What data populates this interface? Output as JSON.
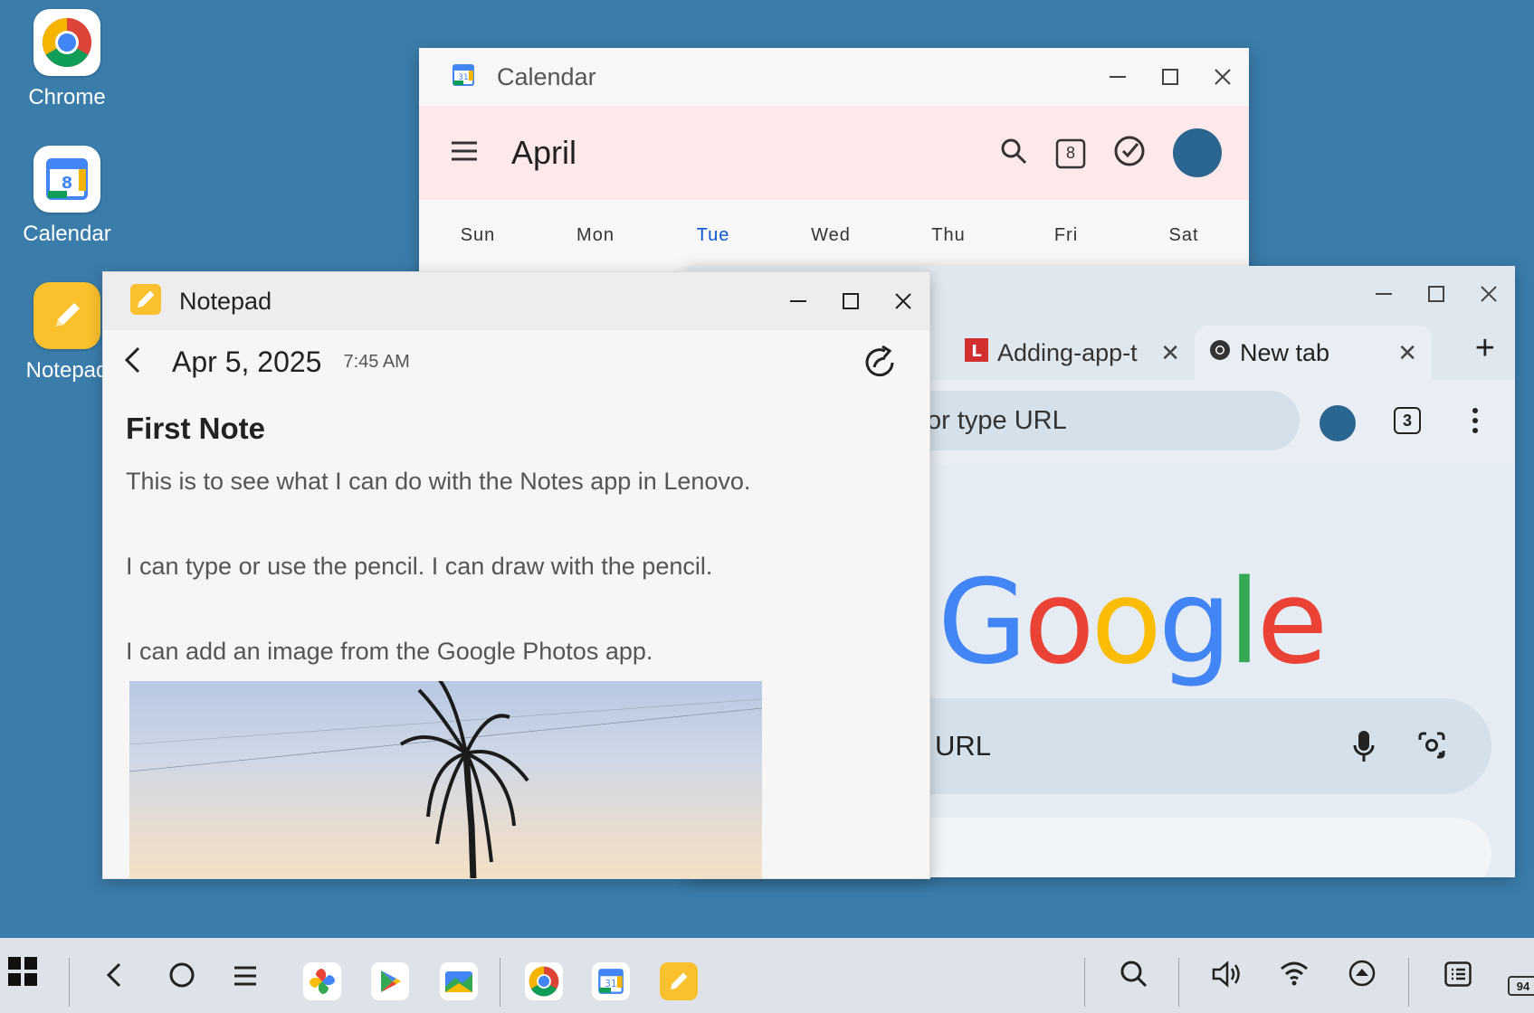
{
  "desktop": {
    "icons": [
      {
        "label": "Chrome"
      },
      {
        "label": "Calendar"
      },
      {
        "label": "Notepad"
      }
    ]
  },
  "calendar": {
    "title": "Calendar",
    "month": "April",
    "date_badge": "8",
    "days": [
      "Sun",
      "Mon",
      "Tue",
      "Wed",
      "Thu",
      "Fri",
      "Sat"
    ],
    "today": "Tue"
  },
  "chrome": {
    "tabs": [
      {
        "label": "Adding-app-t"
      },
      {
        "label": "New tab"
      }
    ],
    "omnibox_placeholder": "or type URL",
    "tab_count": "3",
    "google_logo": "Google",
    "search_placeholder": "URL"
  },
  "notepad": {
    "title": "Notepad",
    "date": "Apr 5, 2025",
    "time": "7:45 AM",
    "heading": "First Note",
    "paragraphs": [
      "This is to see what I can do with the Notes app in Lenovo.",
      "I can type or use the pencil. I can draw with the pencil.",
      "I can add an image from the Google Photos app."
    ]
  },
  "taskbar": {
    "battery": "94"
  },
  "colors": {
    "desktop": "#3a7dab",
    "calendar_header": "#fde8ea",
    "avatar": "#2a6690",
    "today": "#0b57d0"
  }
}
